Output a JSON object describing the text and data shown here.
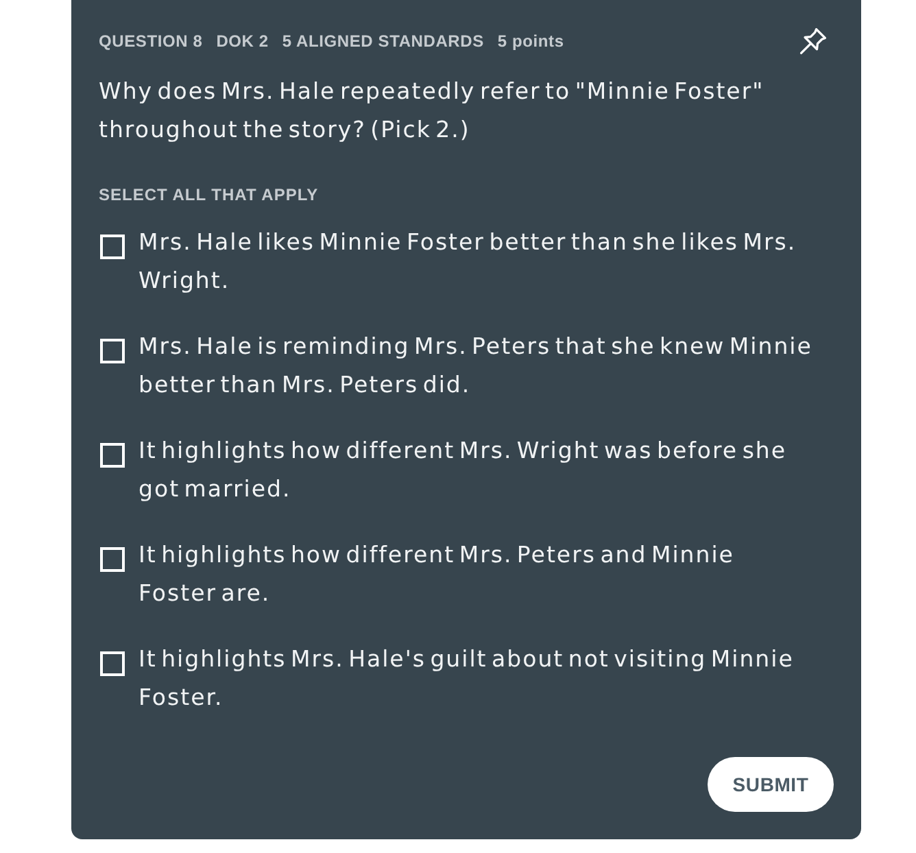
{
  "header": {
    "items": [
      "QUESTION 8",
      "DOK 2",
      "5 ALIGNED STANDARDS",
      "5 points"
    ]
  },
  "question": "Why does Mrs. Hale repeatedly refer to \"Minnie Foster\" throughout the story? (Pick 2.)",
  "instruction": "SELECT ALL THAT APPLY",
  "options": [
    {
      "label": "Mrs. Hale likes Minnie Foster better than she likes Mrs. Wright.",
      "checked": false
    },
    {
      "label": "Mrs. Hale is reminding Mrs. Peters that she knew Minnie better than Mrs. Peters did.",
      "checked": false
    },
    {
      "label": "It highlights how different Mrs. Wright was before she got married.",
      "checked": false
    },
    {
      "label": "It highlights how different Mrs. Peters and Minnie Foster are.",
      "checked": false
    },
    {
      "label": "It highlights Mrs. Hale's guilt about not visiting Minnie Foster.",
      "checked": false
    }
  ],
  "submit_button": "SUBMIT"
}
